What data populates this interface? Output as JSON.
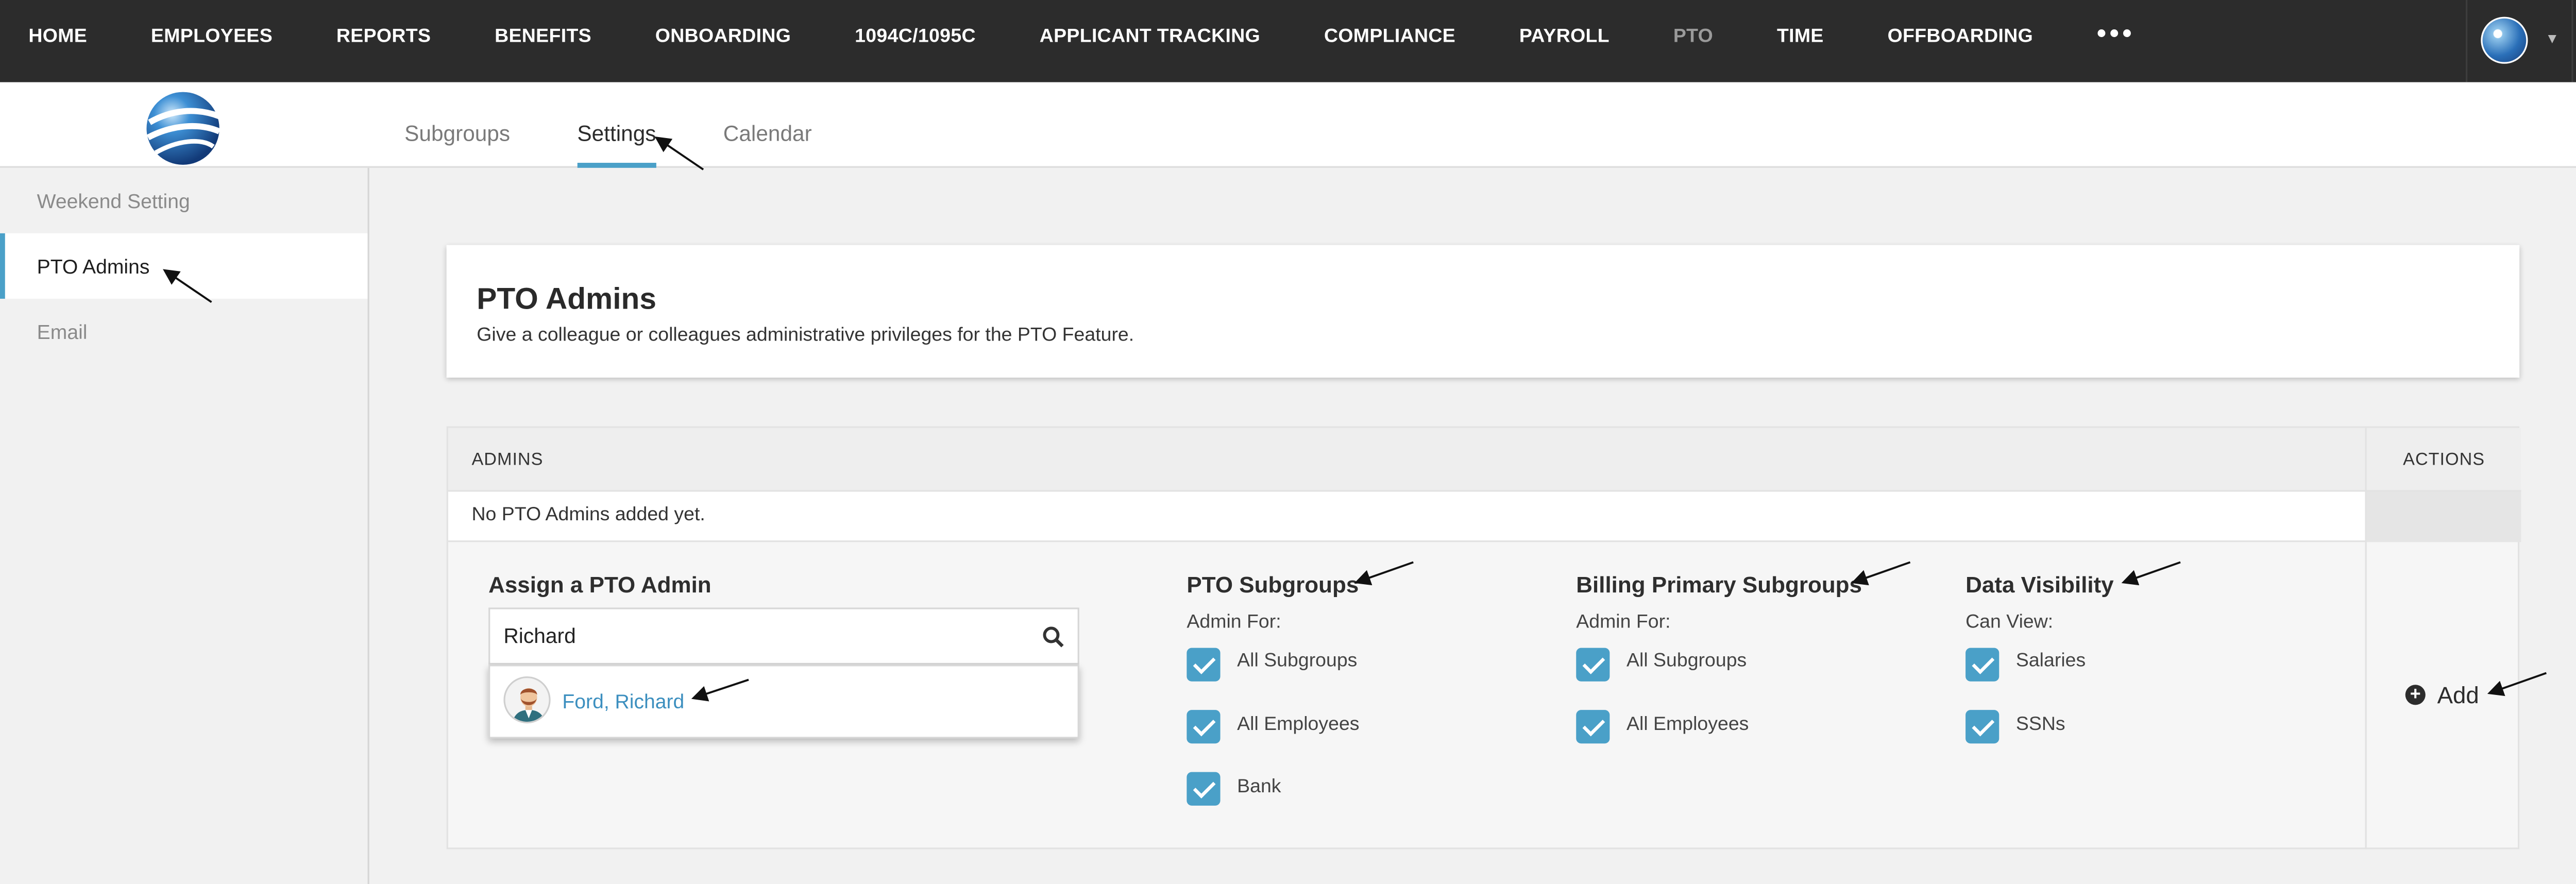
{
  "nav": {
    "items": [
      "HOME",
      "EMPLOYEES",
      "REPORTS",
      "BENEFITS",
      "ONBOARDING",
      "1094C/1095C",
      "APPLICANT TRACKING",
      "COMPLIANCE",
      "PAYROLL",
      "PTO",
      "TIME",
      "OFFBOARDING"
    ],
    "active": "PTO",
    "more": "•••",
    "caret": "▾"
  },
  "tabs": [
    "Subgroups",
    "Settings",
    "Calendar"
  ],
  "sidebar": {
    "items": [
      "Weekend Setting",
      "PTO Admins",
      "Email"
    ]
  },
  "card": {
    "title": "PTO Admins",
    "subtitle": "Give a colleague or colleagues administrative privileges for the PTO Feature."
  },
  "table": {
    "header_admins": "ADMINS",
    "header_actions": "ACTIONS",
    "empty_text": "No PTO Admins added yet."
  },
  "assign": {
    "title": "Assign a PTO Admin",
    "search_value": "Richard",
    "result_name": "Ford, Richard"
  },
  "pto_subgroups": {
    "title": "PTO Subgroups",
    "label": "Admin For:",
    "options": [
      "All Subgroups",
      "All Employees",
      "Bank"
    ]
  },
  "billing_subgroups": {
    "title": "Billing Primary Subgroups",
    "label": "Admin For:",
    "options": [
      "All Subgroups",
      "All Employees"
    ]
  },
  "data_visibility": {
    "title": "Data Visibility",
    "label": "Can View:",
    "options": [
      "Salaries",
      "SSNs"
    ]
  },
  "actions": {
    "add_label": "Add",
    "add_symbol": "+"
  },
  "colors": {
    "accent": "#4aa0c8",
    "topbar": "#2c2c2c",
    "link": "#3c8fbf"
  }
}
